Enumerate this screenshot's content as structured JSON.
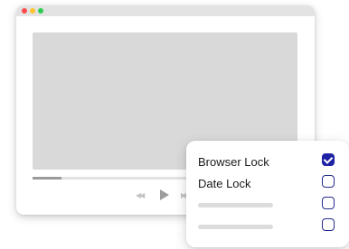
{
  "window": {
    "traffic_lights": [
      "close",
      "minimize",
      "maximize"
    ],
    "colors": {
      "close": "#ff4b4b",
      "minimize": "#ffc42e",
      "maximize": "#2ecc55"
    }
  },
  "player": {
    "progress": 0.11,
    "controls": {
      "rewind_icon": "rewind-icon",
      "play_icon": "play-icon",
      "forward_icon": "fast-forward-icon",
      "rewind_glyph": "◀◀",
      "forward_glyph": "▶▶"
    }
  },
  "lock_panel": {
    "items": [
      {
        "label": "Browser Lock",
        "checked": true
      },
      {
        "label": "Date Lock",
        "checked": false
      },
      {
        "label": "",
        "checked": false
      },
      {
        "label": "",
        "checked": false
      }
    ],
    "accent_color": "#1d22a5"
  }
}
